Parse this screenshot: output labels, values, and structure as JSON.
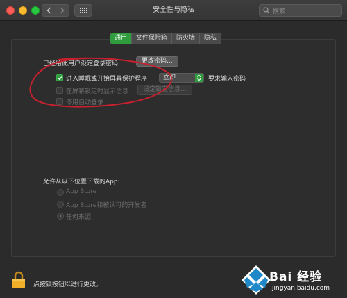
{
  "window": {
    "title": "安全性与隐私"
  },
  "search": {
    "placeholder": "搜索"
  },
  "tabs": [
    {
      "label": "通用",
      "active": true
    },
    {
      "label": "文件保险箱",
      "active": false
    },
    {
      "label": "防火墙",
      "active": false
    },
    {
      "label": "隐私",
      "active": false
    }
  ],
  "general": {
    "password_label": "已经给此用户设定登录密码",
    "change_password_button": "更改密码...",
    "require_password": {
      "label": "进入睡眠或开始屏幕保护程序",
      "checked": true,
      "delay_value": "立即",
      "suffix": "要求输入密码"
    },
    "show_message": {
      "label": "在屏幕锁定时显示信息",
      "checked": false,
      "disabled": true,
      "button": "设定锁定信息..."
    },
    "disable_autologin": {
      "label": "停用自动登录",
      "checked": false,
      "disabled": true
    }
  },
  "downloads": {
    "heading": "允许从以下位置下载的App:",
    "options": [
      {
        "label": "App Store",
        "selected": false
      },
      {
        "label": "App Store和被认可的开发者",
        "selected": false
      },
      {
        "label": "任何来源",
        "selected": true
      }
    ]
  },
  "footer": {
    "lock_text": "点按锁按钮以进行更改。"
  },
  "watermark": {
    "brand": "Bai 经验",
    "url": "jingyan.baidu.com"
  },
  "colors": {
    "accent": "#2f9c3d",
    "annotation": "#c8202e",
    "background": "#2b2b2b"
  }
}
